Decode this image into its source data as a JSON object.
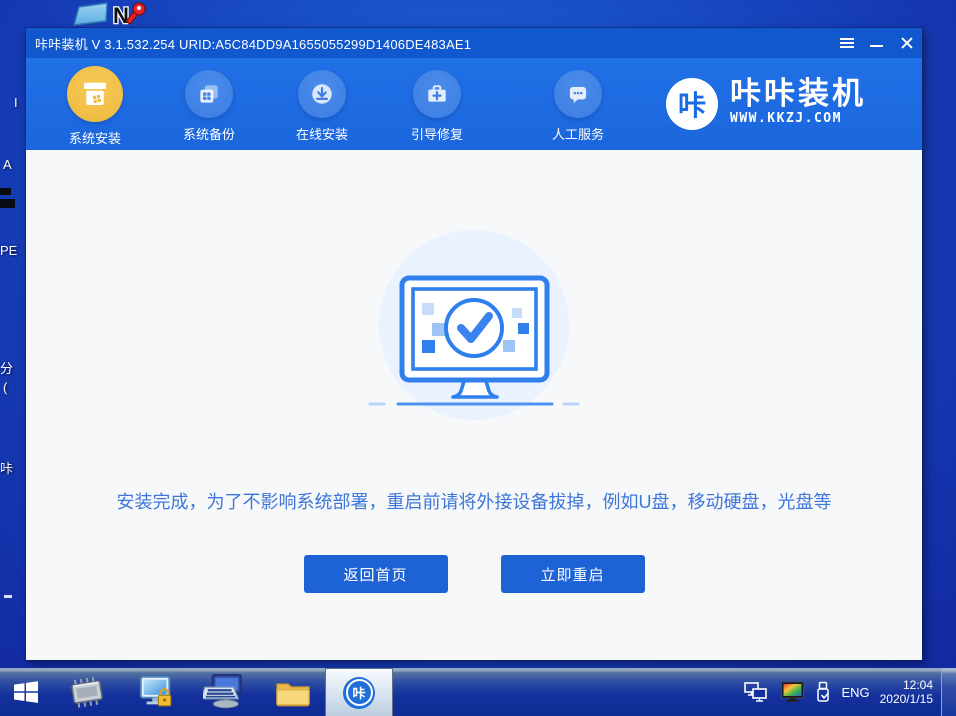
{
  "desktop": {
    "top_icons": [
      "blue-folder",
      "n-key-app"
    ],
    "fragments": [
      {
        "text": "I"
      },
      {
        "text": "A"
      },
      {
        "text": "PE"
      },
      {
        "text": "分"
      },
      {
        "text": "("
      },
      {
        "text": "咔"
      }
    ]
  },
  "window": {
    "title": "咔咔装机 V 3.1.532.254 URID:A5C84DD9A1655055299D1406DE483AE1",
    "nav": {
      "items": [
        {
          "label": "系统安装",
          "active": true
        },
        {
          "label": "系统备份",
          "active": false
        },
        {
          "label": "在线安装",
          "active": false
        },
        {
          "label": "引导修复",
          "active": false
        },
        {
          "label": "人工服务",
          "active": false
        }
      ]
    },
    "logo": {
      "glyph": "咔",
      "name": "咔咔装机",
      "site": "WWW.KKZJ.COM"
    },
    "main": {
      "message": "安装完成，为了不影响系统部署，重启前请将外接设备拔掉，例如U盘，移动硬盘，光盘等",
      "home_button": "返回首页",
      "restart_button": "立即重启"
    }
  },
  "taskbar": {
    "kaka_glyph": "咔",
    "tray": {
      "language": "ENG",
      "time": "12:04",
      "date": "2020/1/15"
    }
  },
  "colors": {
    "titlebar": "#1157ce",
    "header": "#1e6ce2",
    "accent": "#2f80ed",
    "active_gold": "#f2c04a",
    "button_blue": "#1e63d6",
    "desktop_blue": "#1747c0",
    "message_blue": "#3e76da"
  }
}
